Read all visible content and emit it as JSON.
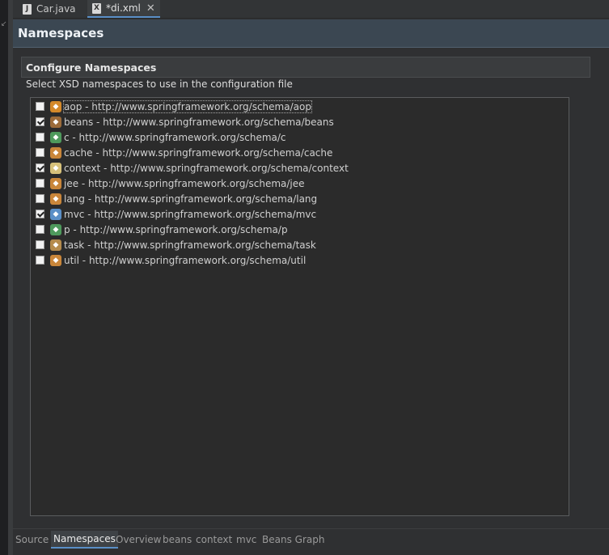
{
  "editor_tabs": [
    {
      "label": "Car.java",
      "icon": "java-file-icon",
      "active": false
    },
    {
      "label": "*di.xml",
      "icon": "xml-file-icon",
      "active": true,
      "closable": true
    }
  ],
  "page": {
    "title": "Namespaces",
    "section_title": "Configure Namespaces",
    "description": "Select XSD namespaces to use in the configuration file"
  },
  "namespaces": [
    {
      "label": "aop - http://www.springframework.org/schema/aop",
      "checked": false,
      "icon": "aop-namespace-icon",
      "icon_color": "#d4892a",
      "focused": true
    },
    {
      "label": "beans - http://www.springframework.org/schema/beans",
      "checked": true,
      "icon": "beans-namespace-icon",
      "icon_color": "#9c6b3a"
    },
    {
      "label": "c - http://www.springframework.org/schema/c",
      "checked": false,
      "icon": "c-namespace-icon",
      "icon_color": "#4e9a5c"
    },
    {
      "label": "cache - http://www.springframework.org/schema/cache",
      "checked": false,
      "icon": "cache-namespace-icon",
      "icon_color": "#c9863a"
    },
    {
      "label": "context - http://www.springframework.org/schema/context",
      "checked": true,
      "icon": "context-namespace-icon",
      "icon_color": "#d7c17a"
    },
    {
      "label": "jee - http://www.springframework.org/schema/jee",
      "checked": false,
      "icon": "jee-namespace-icon",
      "icon_color": "#c9863a"
    },
    {
      "label": "lang - http://www.springframework.org/schema/lang",
      "checked": false,
      "icon": "lang-namespace-icon",
      "icon_color": "#c9863a"
    },
    {
      "label": "mvc - http://www.springframework.org/schema/mvc",
      "checked": true,
      "icon": "mvc-namespace-icon",
      "icon_color": "#5a8fc7"
    },
    {
      "label": "p - http://www.springframework.org/schema/p",
      "checked": false,
      "icon": "p-namespace-icon",
      "icon_color": "#4e9a5c"
    },
    {
      "label": "task - http://www.springframework.org/schema/task",
      "checked": false,
      "icon": "task-namespace-icon",
      "icon_color": "#b58b4c"
    },
    {
      "label": "util - http://www.springframework.org/schema/util",
      "checked": false,
      "icon": "util-namespace-icon",
      "icon_color": "#c9863a"
    }
  ],
  "bottom_tabs": [
    {
      "label": "Source",
      "active": false
    },
    {
      "label": "Namespaces",
      "active": true
    },
    {
      "label": "Overview",
      "active": false
    },
    {
      "label": "beans",
      "active": false
    },
    {
      "label": "context",
      "active": false
    },
    {
      "label": "mvc",
      "active": false
    },
    {
      "label": "Beans Graph",
      "active": false
    }
  ],
  "colors": {
    "accent": "#5a8fc7",
    "header_bg": "#3b4752",
    "background": "#2b2b2b"
  }
}
